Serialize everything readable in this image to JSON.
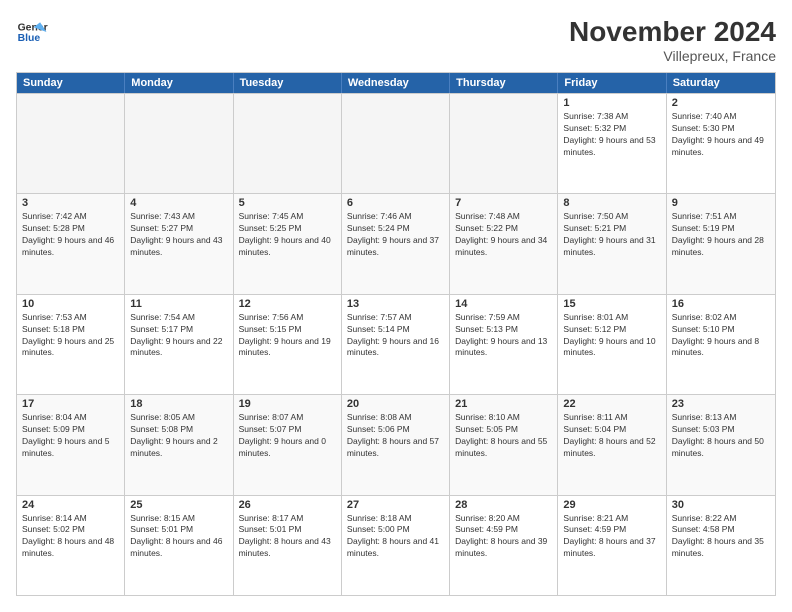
{
  "logo": {
    "line1": "General",
    "line2": "Blue"
  },
  "title": "November 2024",
  "location": "Villepreux, France",
  "header_days": [
    "Sunday",
    "Monday",
    "Tuesday",
    "Wednesday",
    "Thursday",
    "Friday",
    "Saturday"
  ],
  "weeks": [
    [
      {
        "day": "",
        "empty": true
      },
      {
        "day": "",
        "empty": true
      },
      {
        "day": "",
        "empty": true
      },
      {
        "day": "",
        "empty": true
      },
      {
        "day": "",
        "empty": true
      },
      {
        "day": "1",
        "sunrise": "Sunrise: 7:38 AM",
        "sunset": "Sunset: 5:32 PM",
        "daylight": "Daylight: 9 hours and 53 minutes."
      },
      {
        "day": "2",
        "sunrise": "Sunrise: 7:40 AM",
        "sunset": "Sunset: 5:30 PM",
        "daylight": "Daylight: 9 hours and 49 minutes."
      }
    ],
    [
      {
        "day": "3",
        "sunrise": "Sunrise: 7:42 AM",
        "sunset": "Sunset: 5:28 PM",
        "daylight": "Daylight: 9 hours and 46 minutes."
      },
      {
        "day": "4",
        "sunrise": "Sunrise: 7:43 AM",
        "sunset": "Sunset: 5:27 PM",
        "daylight": "Daylight: 9 hours and 43 minutes."
      },
      {
        "day": "5",
        "sunrise": "Sunrise: 7:45 AM",
        "sunset": "Sunset: 5:25 PM",
        "daylight": "Daylight: 9 hours and 40 minutes."
      },
      {
        "day": "6",
        "sunrise": "Sunrise: 7:46 AM",
        "sunset": "Sunset: 5:24 PM",
        "daylight": "Daylight: 9 hours and 37 minutes."
      },
      {
        "day": "7",
        "sunrise": "Sunrise: 7:48 AM",
        "sunset": "Sunset: 5:22 PM",
        "daylight": "Daylight: 9 hours and 34 minutes."
      },
      {
        "day": "8",
        "sunrise": "Sunrise: 7:50 AM",
        "sunset": "Sunset: 5:21 PM",
        "daylight": "Daylight: 9 hours and 31 minutes."
      },
      {
        "day": "9",
        "sunrise": "Sunrise: 7:51 AM",
        "sunset": "Sunset: 5:19 PM",
        "daylight": "Daylight: 9 hours and 28 minutes."
      }
    ],
    [
      {
        "day": "10",
        "sunrise": "Sunrise: 7:53 AM",
        "sunset": "Sunset: 5:18 PM",
        "daylight": "Daylight: 9 hours and 25 minutes."
      },
      {
        "day": "11",
        "sunrise": "Sunrise: 7:54 AM",
        "sunset": "Sunset: 5:17 PM",
        "daylight": "Daylight: 9 hours and 22 minutes."
      },
      {
        "day": "12",
        "sunrise": "Sunrise: 7:56 AM",
        "sunset": "Sunset: 5:15 PM",
        "daylight": "Daylight: 9 hours and 19 minutes."
      },
      {
        "day": "13",
        "sunrise": "Sunrise: 7:57 AM",
        "sunset": "Sunset: 5:14 PM",
        "daylight": "Daylight: 9 hours and 16 minutes."
      },
      {
        "day": "14",
        "sunrise": "Sunrise: 7:59 AM",
        "sunset": "Sunset: 5:13 PM",
        "daylight": "Daylight: 9 hours and 13 minutes."
      },
      {
        "day": "15",
        "sunrise": "Sunrise: 8:01 AM",
        "sunset": "Sunset: 5:12 PM",
        "daylight": "Daylight: 9 hours and 10 minutes."
      },
      {
        "day": "16",
        "sunrise": "Sunrise: 8:02 AM",
        "sunset": "Sunset: 5:10 PM",
        "daylight": "Daylight: 9 hours and 8 minutes."
      }
    ],
    [
      {
        "day": "17",
        "sunrise": "Sunrise: 8:04 AM",
        "sunset": "Sunset: 5:09 PM",
        "daylight": "Daylight: 9 hours and 5 minutes."
      },
      {
        "day": "18",
        "sunrise": "Sunrise: 8:05 AM",
        "sunset": "Sunset: 5:08 PM",
        "daylight": "Daylight: 9 hours and 2 minutes."
      },
      {
        "day": "19",
        "sunrise": "Sunrise: 8:07 AM",
        "sunset": "Sunset: 5:07 PM",
        "daylight": "Daylight: 9 hours and 0 minutes."
      },
      {
        "day": "20",
        "sunrise": "Sunrise: 8:08 AM",
        "sunset": "Sunset: 5:06 PM",
        "daylight": "Daylight: 8 hours and 57 minutes."
      },
      {
        "day": "21",
        "sunrise": "Sunrise: 8:10 AM",
        "sunset": "Sunset: 5:05 PM",
        "daylight": "Daylight: 8 hours and 55 minutes."
      },
      {
        "day": "22",
        "sunrise": "Sunrise: 8:11 AM",
        "sunset": "Sunset: 5:04 PM",
        "daylight": "Daylight: 8 hours and 52 minutes."
      },
      {
        "day": "23",
        "sunrise": "Sunrise: 8:13 AM",
        "sunset": "Sunset: 5:03 PM",
        "daylight": "Daylight: 8 hours and 50 minutes."
      }
    ],
    [
      {
        "day": "24",
        "sunrise": "Sunrise: 8:14 AM",
        "sunset": "Sunset: 5:02 PM",
        "daylight": "Daylight: 8 hours and 48 minutes."
      },
      {
        "day": "25",
        "sunrise": "Sunrise: 8:15 AM",
        "sunset": "Sunset: 5:01 PM",
        "daylight": "Daylight: 8 hours and 46 minutes."
      },
      {
        "day": "26",
        "sunrise": "Sunrise: 8:17 AM",
        "sunset": "Sunset: 5:01 PM",
        "daylight": "Daylight: 8 hours and 43 minutes."
      },
      {
        "day": "27",
        "sunrise": "Sunrise: 8:18 AM",
        "sunset": "Sunset: 5:00 PM",
        "daylight": "Daylight: 8 hours and 41 minutes."
      },
      {
        "day": "28",
        "sunrise": "Sunrise: 8:20 AM",
        "sunset": "Sunset: 4:59 PM",
        "daylight": "Daylight: 8 hours and 39 minutes."
      },
      {
        "day": "29",
        "sunrise": "Sunrise: 8:21 AM",
        "sunset": "Sunset: 4:59 PM",
        "daylight": "Daylight: 8 hours and 37 minutes."
      },
      {
        "day": "30",
        "sunrise": "Sunrise: 8:22 AM",
        "sunset": "Sunset: 4:58 PM",
        "daylight": "Daylight: 8 hours and 35 minutes."
      }
    ]
  ]
}
